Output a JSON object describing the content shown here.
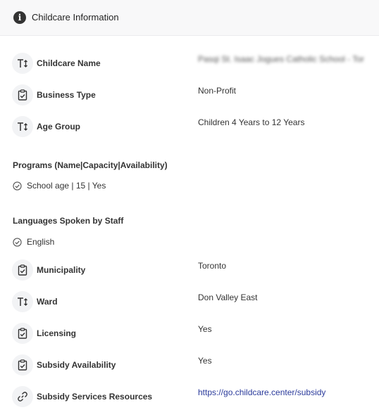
{
  "header": {
    "icon": "info-icon",
    "title": "Childcare Information"
  },
  "fields": {
    "childcare_name": {
      "icon": "text-icon",
      "label": "Childcare Name",
      "value": "Pasqi St. Isaac Jogues Catholic School - Tor"
    },
    "business_type": {
      "icon": "clipboard-icon",
      "label": "Business Type",
      "value": "Non-Profit"
    },
    "age_group": {
      "icon": "text-icon",
      "label": "Age Group",
      "value": "Children 4 Years to 12 Years"
    },
    "municipality": {
      "icon": "clipboard-icon",
      "label": "Municipality",
      "value": "Toronto"
    },
    "ward": {
      "icon": "text-icon",
      "label": "Ward",
      "value": "Don Valley East"
    },
    "licensing": {
      "icon": "clipboard-icon",
      "label": "Licensing",
      "value": "Yes"
    },
    "subsidy_availability": {
      "icon": "clipboard-icon",
      "label": "Subsidy Availability",
      "value": "Yes"
    },
    "subsidy_services": {
      "icon": "link-icon",
      "label": "Subsidy Services Resources",
      "value": "https://go.childcare.center/subsidy"
    }
  },
  "programs": {
    "title": "Programs (Name|Capacity|Availability)",
    "items": [
      "School age | 15 | Yes"
    ]
  },
  "languages": {
    "title": "Languages Spoken by Staff",
    "items": [
      "English"
    ]
  }
}
